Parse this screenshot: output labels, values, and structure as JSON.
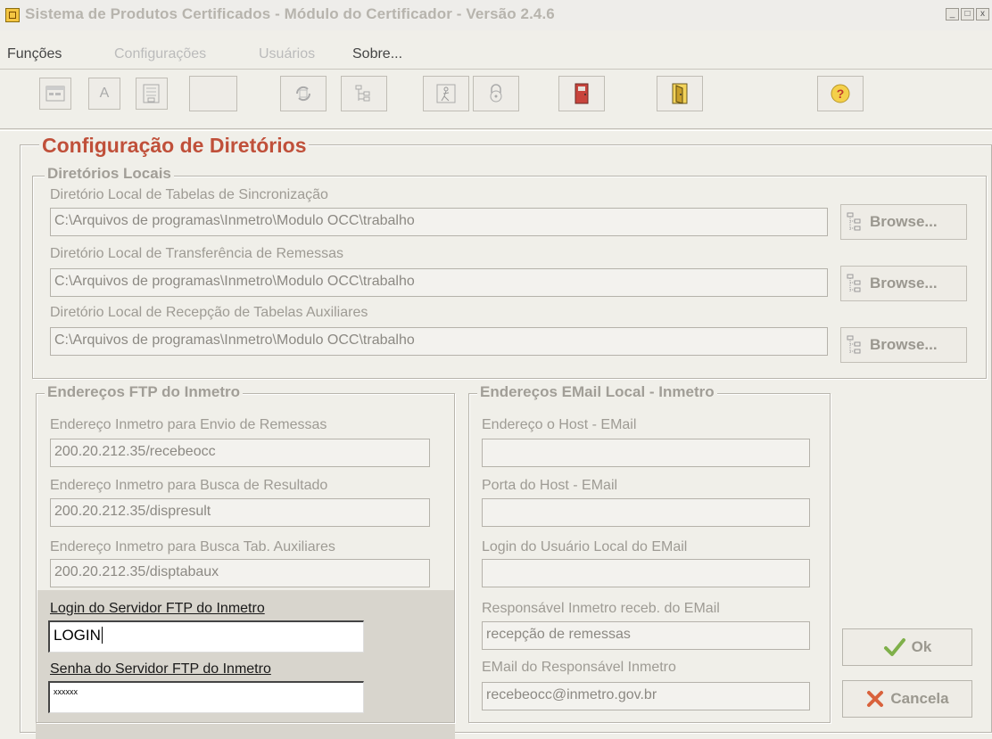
{
  "window": {
    "title": "Sistema de Produtos Certificados - Módulo do Certificador - Versão 2.4.6",
    "controls": [
      "_",
      "□",
      "x"
    ]
  },
  "menu": [
    {
      "label": "Funções",
      "enabled": true
    },
    {
      "label": "Configurações",
      "enabled": false
    },
    {
      "label": "Usuários",
      "enabled": false
    },
    {
      "label": "Sobre...",
      "enabled": true
    }
  ],
  "toolbar": {
    "buttons": [
      "window-icon",
      "font-a-icon",
      "list-window-icon",
      "blank-icon",
      "refresh-icon",
      "tree-icon",
      "person-icon",
      "lock-icon",
      "exit-door-red-icon",
      "exit-door-open-icon",
      "help-icon"
    ],
    "font_button_label": "A",
    "help_glyph": "?"
  },
  "config": {
    "title": "Configuração de Diretórios",
    "title_color": "#c0503a",
    "local": {
      "title": "Diretórios Locais",
      "sync_label": "Diretório Local de Tabelas de Sincronização",
      "sync_value": "C:\\Arquivos de programas\\Inmetro\\Modulo OCC\\trabalho",
      "transfer_label": "Diretório Local de Transferência de Remessas",
      "transfer_value": "C:\\Arquivos de programas\\Inmetro\\Modulo OCC\\trabalho",
      "reception_label": "Diretório Local de Recepção de Tabelas Auxiliares",
      "reception_value": "C:\\Arquivos de programas\\Inmetro\\Modulo OCC\\trabalho",
      "browse_label": "Browse..."
    },
    "ftp": {
      "title": "Endereços FTP do Inmetro",
      "send_label": "Endereço Inmetro para Envio de Remessas",
      "send_value": "200.20.212.35/recebeocc",
      "result_label": "Endereço Inmetro para Busca de Resultado",
      "result_value": "200.20.212.35/dispresult",
      "aux_label": "Endereço Inmetro para Busca Tab. Auxiliares",
      "aux_value": "200.20.212.35/disptabaux",
      "login_label": "Login do Servidor FTP do Inmetro",
      "login_value": "LOGIN",
      "password_label": "Senha do Servidor FTP do Inmetro",
      "password_value": "xxxxxx"
    },
    "email": {
      "title": "Endereços EMail Local - Inmetro",
      "host_label": "Endereço o Host - EMail",
      "host_value": "",
      "port_label": "Porta do Host - EMail",
      "port_value": "",
      "login_label": "Login do Usuário Local do EMail",
      "login_value": "",
      "responsible_label": "Responsável Inmetro receb. do EMail",
      "responsible_value": "recepção de remessas",
      "responsible_email_label": "EMail do Responsável Inmetro",
      "responsible_email_value": "recebeocc@inmetro.gov.br"
    }
  },
  "actions": {
    "ok_label": "Ok",
    "cancel_label": "Cancela"
  }
}
